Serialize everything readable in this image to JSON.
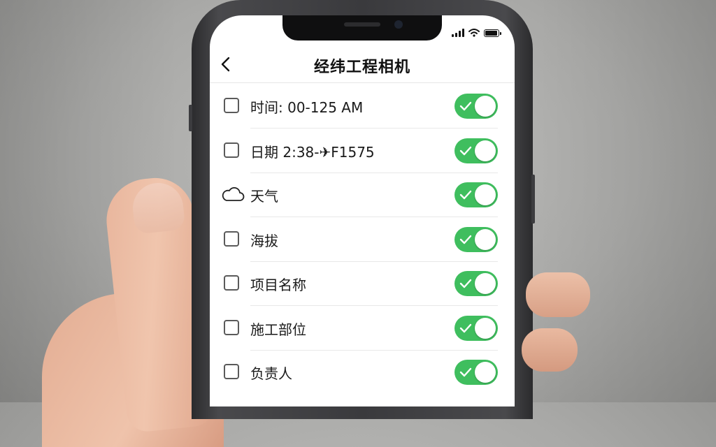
{
  "app": {
    "title": "经纬工程相机"
  },
  "header": {
    "back_icon": "chevron-left-icon"
  },
  "status_bar": {
    "icons": [
      "signal-icon",
      "wifi-icon",
      "battery-icon"
    ]
  },
  "settings": {
    "items": [
      {
        "label": "时间: 00-125 AM",
        "leading": "checkbox",
        "checked": false,
        "enabled": true
      },
      {
        "label": "日期 2:38-✈F1575",
        "leading": "checkbox",
        "checked": false,
        "enabled": true
      },
      {
        "label": "天气",
        "leading": "cloud-icon",
        "checked": false,
        "enabled": true
      },
      {
        "label": "海拔",
        "leading": "checkbox",
        "checked": false,
        "enabled": true
      },
      {
        "label": "项目名称",
        "leading": "checkbox",
        "checked": false,
        "enabled": true
      },
      {
        "label": "施工部位",
        "leading": "checkbox",
        "checked": false,
        "enabled": true
      },
      {
        "label": "负责人",
        "leading": "checkbox",
        "checked": false,
        "enabled": true
      }
    ]
  },
  "colors": {
    "toggle_on": "#3fbe5e",
    "text": "#1a1a1a",
    "divider": "#e8e8e8"
  }
}
